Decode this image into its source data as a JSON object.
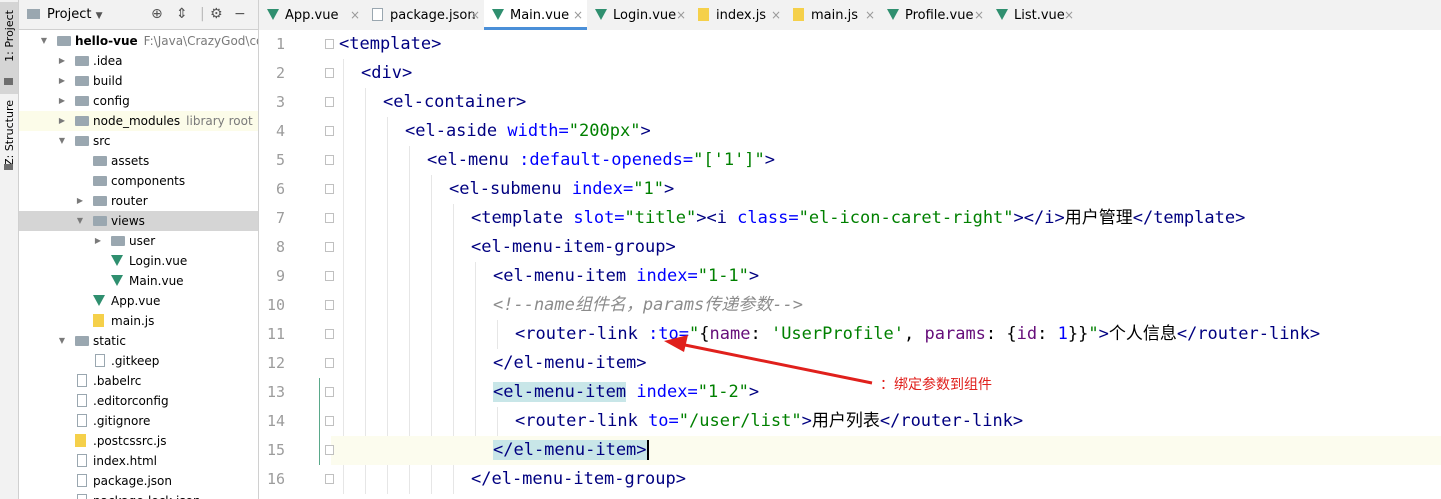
{
  "toolstrip": {
    "project_tab": "1: Project",
    "structure_tab": "Z: Structure"
  },
  "project_panel": {
    "title": "Project",
    "icons": [
      "target-icon",
      "collapse-icon",
      "gear-icon",
      "hide-icon"
    ],
    "tree": [
      {
        "label": "hello-vue",
        "sub": "F:\\Java\\CrazyGod\\code\\",
        "depth": 0,
        "kind": "folder",
        "expanded": true,
        "bold": true
      },
      {
        "label": ".idea",
        "depth": 1,
        "kind": "folder",
        "expanded": false
      },
      {
        "label": "build",
        "depth": 1,
        "kind": "folder",
        "expanded": false
      },
      {
        "label": "config",
        "depth": 1,
        "kind": "folder",
        "expanded": false
      },
      {
        "label": "node_modules",
        "sub": "library root",
        "depth": 1,
        "kind": "folder",
        "expanded": false,
        "highlight": true
      },
      {
        "label": "src",
        "depth": 1,
        "kind": "folder",
        "expanded": true
      },
      {
        "label": "assets",
        "depth": 2,
        "kind": "folder",
        "expanded": null
      },
      {
        "label": "components",
        "depth": 2,
        "kind": "folder",
        "expanded": null
      },
      {
        "label": "router",
        "depth": 2,
        "kind": "folder",
        "expanded": false
      },
      {
        "label": "views",
        "depth": 2,
        "kind": "folder",
        "expanded": true,
        "selected": true
      },
      {
        "label": "user",
        "depth": 3,
        "kind": "folder",
        "expanded": false
      },
      {
        "label": "Login.vue",
        "depth": 3,
        "kind": "vue"
      },
      {
        "label": "Main.vue",
        "depth": 3,
        "kind": "vue"
      },
      {
        "label": "App.vue",
        "depth": 2,
        "kind": "vue"
      },
      {
        "label": "main.js",
        "depth": 2,
        "kind": "js"
      },
      {
        "label": "static",
        "depth": 1,
        "kind": "folder",
        "expanded": true
      },
      {
        "label": ".gitkeep",
        "depth": 2,
        "kind": "file"
      },
      {
        "label": ".babelrc",
        "depth": 1,
        "kind": "file"
      },
      {
        "label": ".editorconfig",
        "depth": 1,
        "kind": "file"
      },
      {
        "label": ".gitignore",
        "depth": 1,
        "kind": "file"
      },
      {
        "label": ".postcssrc.js",
        "depth": 1,
        "kind": "js"
      },
      {
        "label": "index.html",
        "depth": 1,
        "kind": "file"
      },
      {
        "label": "package.json",
        "depth": 1,
        "kind": "file"
      },
      {
        "label": "package-lock.json",
        "depth": 1,
        "kind": "file"
      }
    ]
  },
  "tabs": [
    {
      "label": "App.vue",
      "kind": "vue",
      "active": false
    },
    {
      "label": "package.json",
      "kind": "json",
      "active": false
    },
    {
      "label": "Main.vue",
      "kind": "vue",
      "active": true
    },
    {
      "label": "Login.vue",
      "kind": "vue",
      "active": false
    },
    {
      "label": "index.js",
      "kind": "js",
      "active": false
    },
    {
      "label": "main.js",
      "kind": "js",
      "active": false
    },
    {
      "label": "Profile.vue",
      "kind": "vue",
      "active": false
    },
    {
      "label": "List.vue",
      "kind": "vue",
      "active": false
    }
  ],
  "editor": {
    "current_line": 15,
    "lines": [
      {
        "n": "1",
        "indent": 0,
        "tokens": [
          [
            "tg",
            "<template>"
          ]
        ]
      },
      {
        "n": "2",
        "indent": 1,
        "tokens": [
          [
            "tg",
            "<div>"
          ]
        ]
      },
      {
        "n": "3",
        "indent": 2,
        "tokens": [
          [
            "tg",
            "<el-container>"
          ]
        ]
      },
      {
        "n": "4",
        "indent": 3,
        "tokens": [
          [
            "tg",
            "<el-aside "
          ],
          [
            "at",
            "width="
          ],
          [
            "str",
            "\"200px\""
          ],
          [
            "tg",
            ">"
          ]
        ]
      },
      {
        "n": "5",
        "indent": 4,
        "tokens": [
          [
            "tg",
            "<el-menu "
          ],
          [
            "at",
            ":default-openeds="
          ],
          [
            "str",
            "\"['1']\""
          ],
          [
            "tg",
            ">"
          ]
        ]
      },
      {
        "n": "6",
        "indent": 5,
        "tokens": [
          [
            "tg",
            "<el-submenu "
          ],
          [
            "at",
            "index="
          ],
          [
            "str",
            "\"1\""
          ],
          [
            "tg",
            ">"
          ]
        ]
      },
      {
        "n": "7",
        "indent": 6,
        "tokens": [
          [
            "tg",
            "<template "
          ],
          [
            "at",
            "slot="
          ],
          [
            "str",
            "\"title\""
          ],
          [
            "tg",
            ">"
          ],
          [
            "tg",
            "<i "
          ],
          [
            "at",
            "class="
          ],
          [
            "str",
            "\"el-icon-caret-right\""
          ],
          [
            "tg",
            "></i>"
          ],
          [
            "tx",
            "用户管理"
          ],
          [
            "tg",
            "</template>"
          ]
        ]
      },
      {
        "n": "8",
        "indent": 6,
        "tokens": [
          [
            "tg",
            "<el-menu-item-group>"
          ]
        ]
      },
      {
        "n": "9",
        "indent": 7,
        "tokens": [
          [
            "tg",
            "<el-menu-item "
          ],
          [
            "at",
            "index="
          ],
          [
            "str",
            "\"1-1\""
          ],
          [
            "tg",
            ">"
          ]
        ]
      },
      {
        "n": "10",
        "indent": 7,
        "tokens": [
          [
            "cm",
            "<!--name组件名，params传递参数-->"
          ]
        ]
      },
      {
        "n": "11",
        "indent": 8,
        "tokens": [
          [
            "tg",
            "<router-link "
          ],
          [
            "at",
            ":to="
          ],
          [
            "str",
            "\""
          ],
          [
            "tx",
            "{"
          ],
          [
            "pn",
            "name"
          ],
          [
            "tx",
            ": "
          ],
          [
            "str",
            "'UserProfile'"
          ],
          [
            "tx",
            ", "
          ],
          [
            "pn",
            "params"
          ],
          [
            "tx",
            ": {"
          ],
          [
            "pn",
            "id"
          ],
          [
            "tx",
            ": "
          ],
          [
            "at",
            "1"
          ],
          [
            "tx",
            "}}"
          ],
          [
            "str",
            "\""
          ],
          [
            "tg",
            ">"
          ],
          [
            "tx",
            "个人信息"
          ],
          [
            "tg",
            "</router-link>"
          ]
        ]
      },
      {
        "n": "12",
        "indent": 7,
        "tokens": [
          [
            "tg",
            "</el-menu-item>"
          ]
        ]
      },
      {
        "n": "13",
        "indent": 7,
        "tokens": [
          [
            "tghl",
            "<el-menu-item"
          ],
          [
            "tg",
            " "
          ],
          [
            "at",
            "index="
          ],
          [
            "str",
            "\"1-2\""
          ],
          [
            "tg",
            ">"
          ]
        ]
      },
      {
        "n": "14",
        "indent": 8,
        "tokens": [
          [
            "tg",
            "<router-link "
          ],
          [
            "at",
            "to="
          ],
          [
            "str",
            "\"/user/list\""
          ],
          [
            "tg",
            ">"
          ],
          [
            "tx",
            "用户列表"
          ],
          [
            "tg",
            "</router-link>"
          ]
        ]
      },
      {
        "n": "15",
        "indent": 7,
        "tokens": [
          [
            "tghl",
            "</el-menu-item>"
          ],
          [
            "cursor",
            ""
          ]
        ]
      },
      {
        "n": "16",
        "indent": 6,
        "tokens": [
          [
            "tg",
            "</el-menu-item-group>"
          ]
        ]
      }
    ]
  },
  "annotation": {
    "text": "：绑定参数到组件",
    "color": "#e0201c"
  }
}
